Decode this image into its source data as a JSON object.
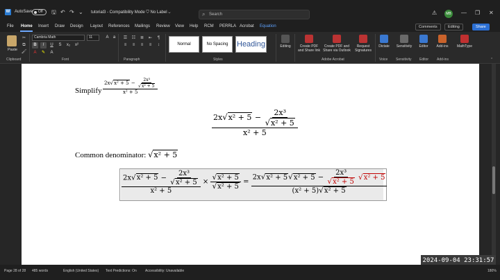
{
  "titlebar": {
    "autosave_label": "AutoSave",
    "autosave_state": "Off",
    "doc_title": "tutorial3 - Compatibility Mode",
    "label_status": "No Label",
    "search_placeholder": "Search",
    "avatar_initials": "MB"
  },
  "tabs": [
    "File",
    "Home",
    "Insert",
    "Draw",
    "Design",
    "Layout",
    "References",
    "Mailings",
    "Review",
    "View",
    "Help",
    "RCM",
    "PERRLA",
    "Acrobat",
    "Equation"
  ],
  "active_tab": "Home",
  "toolbar_buttons": {
    "comments": "Comments",
    "editing": "Editing",
    "share": "Share"
  },
  "ribbon": {
    "paste_label": "Paste",
    "font_name": "Cambria Math",
    "font_size": "11",
    "format_buttons": [
      "B",
      "I",
      "U"
    ],
    "styles": [
      "Normal",
      "No Spacing",
      "Heading"
    ],
    "editing_label": "Editing",
    "adobe_buttons": [
      "Create PDF and Share link",
      "Create PDF and Share via Outlook",
      "Request Signatures"
    ],
    "right_buttons": [
      "Dictate",
      "Sensitivity",
      "Editor",
      "Add-ins",
      "MathType"
    ],
    "group_labels": [
      "Clipboard",
      "Font",
      "Paragraph",
      "Styles",
      "Adobe Acrobat",
      "Voice",
      "Sensitivity",
      "Editor",
      "Add-ins"
    ]
  },
  "document": {
    "simplify_label": "Simplify",
    "common_denominator_label": "Common denominator:",
    "expr": {
      "coef": "2x",
      "radicand": "x² + 5",
      "minus": "−",
      "inner_num": "2x³",
      "denominator": "x² + 5",
      "times": "×",
      "equals": "=",
      "result_den": "(x² + 5)"
    },
    "common_radicand": "x² + 5"
  },
  "statusbar": {
    "page": "Page 28 of 28",
    "words": "485 words",
    "language": "English (United States)",
    "text_predictions": "Text Predictions: On",
    "accessibility": "Accessibility: Unavailable",
    "zoom": "180%"
  },
  "timestamp": "2024-09-04 23:31:57",
  "colors": {
    "accent": "#2b6fd3",
    "red_term": "#c00000",
    "word_blue": "#2b7cd3"
  }
}
